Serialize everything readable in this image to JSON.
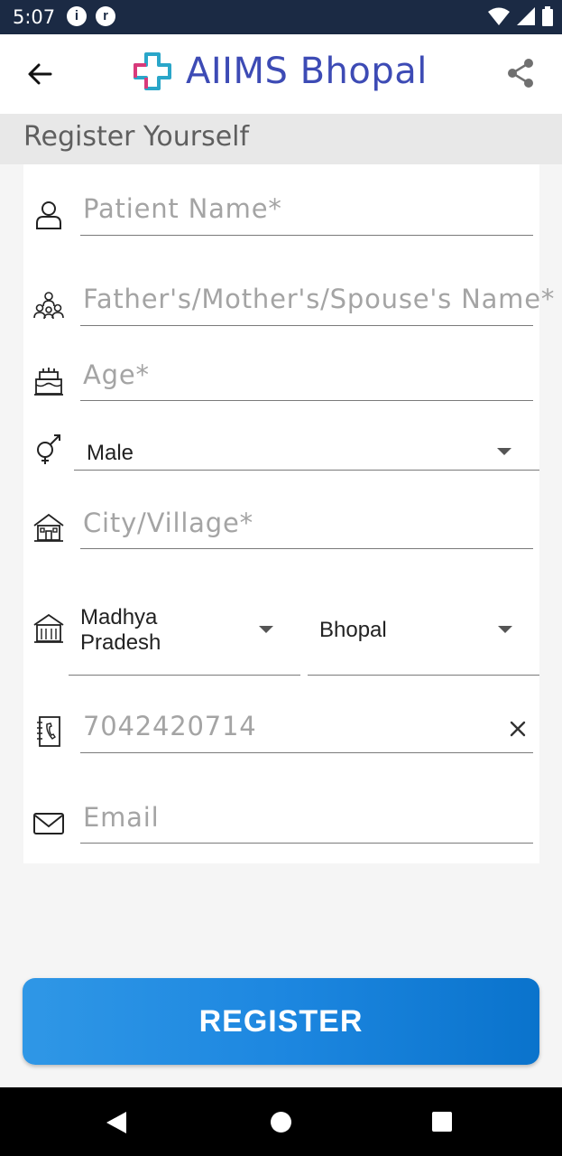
{
  "status_bar": {
    "time": "5:07"
  },
  "app_bar": {
    "brand": "AIIMS Bhopal"
  },
  "section": {
    "title": "Register Yourself"
  },
  "form": {
    "patient_name_placeholder": "Patient Name*",
    "guardian_name_placeholder": "Father's/Mother's/Spouse's Name*",
    "age_placeholder": "Age*",
    "gender_value": "Male",
    "city_placeholder": "City/Village*",
    "state_value_line1": "Madhya",
    "state_value_line2": "Pradesh",
    "district_value": "Bhopal",
    "mobile_placeholder": "7042420714",
    "email_placeholder": "Email"
  },
  "register_button": {
    "label": "REGISTER"
  },
  "colors": {
    "status_bar": "#1b2a44",
    "brand_text": "#3d4bb5",
    "button_start": "#2f97e6",
    "button_end": "#0a73cc"
  },
  "icons": [
    "info-icon",
    "app-notification-icon",
    "wifi-icon",
    "signal-icon",
    "battery-icon",
    "back-arrow-icon",
    "logo-cross-icon",
    "share-icon",
    "person-icon",
    "family-icon",
    "cake-icon",
    "gender-icon",
    "house-icon",
    "building-icon",
    "phone-book-icon",
    "clear-icon",
    "mail-icon"
  ]
}
